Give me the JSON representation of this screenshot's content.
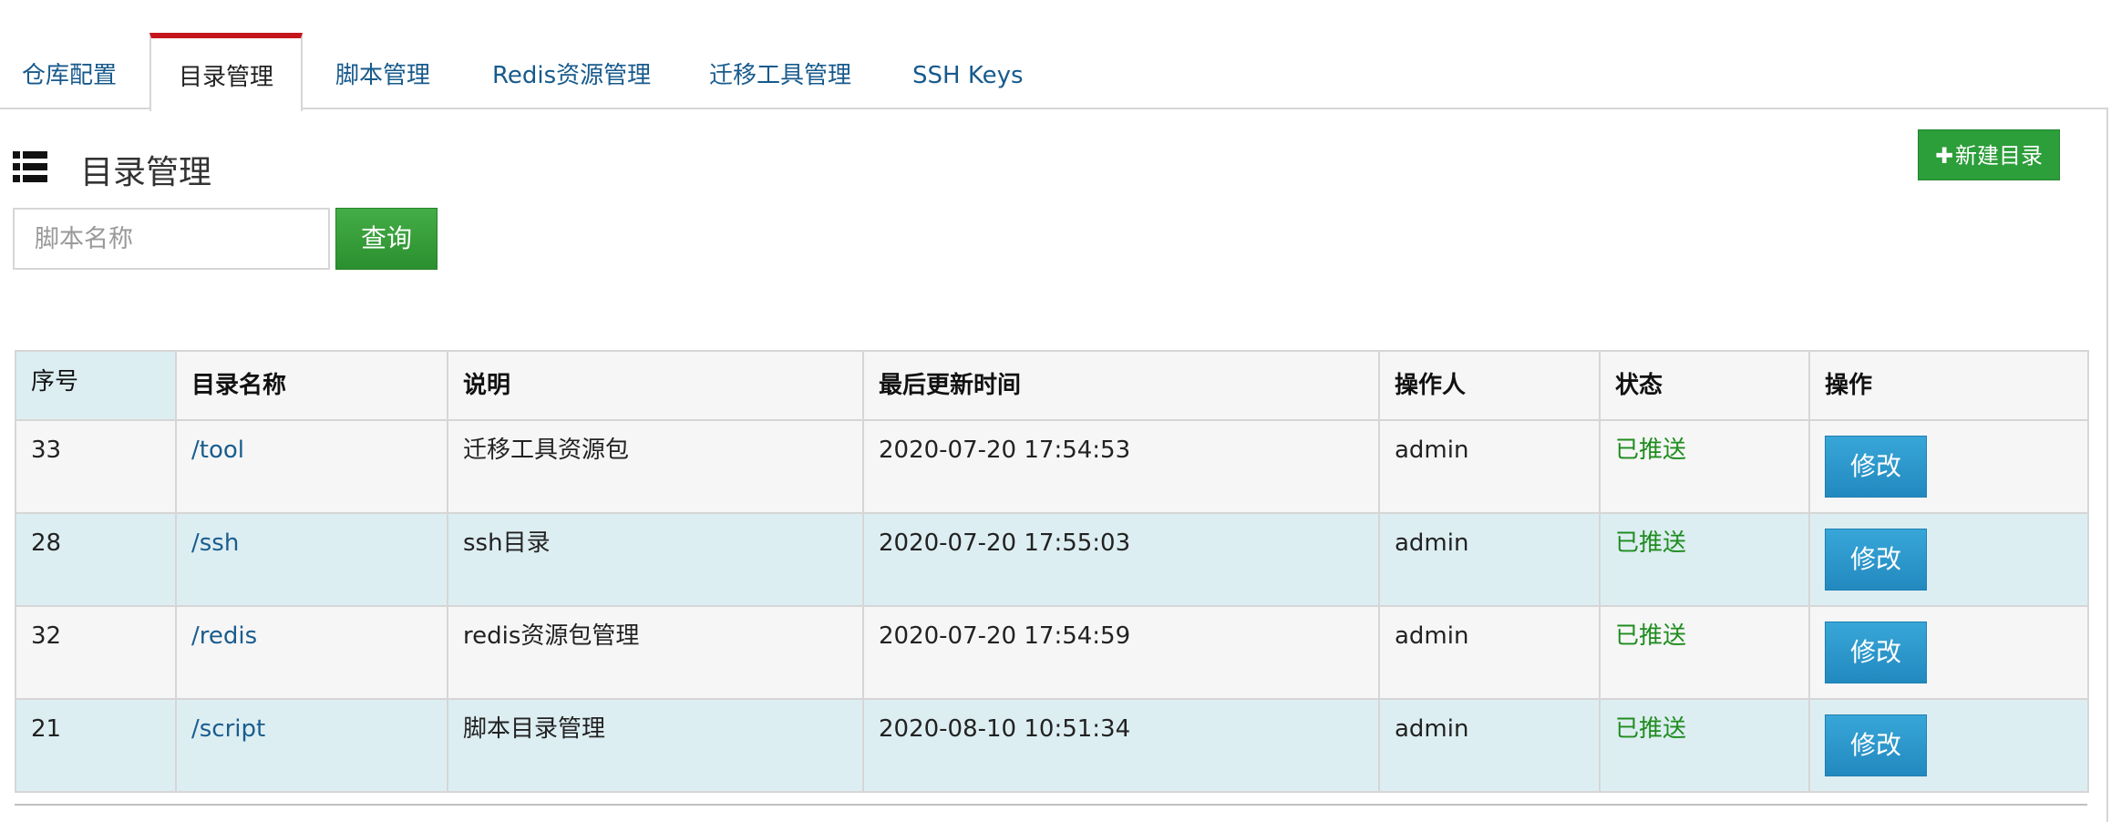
{
  "tabs": [
    {
      "label": "仓库配置"
    },
    {
      "label": "目录管理",
      "active": true
    },
    {
      "label": "脚本管理"
    },
    {
      "label": "Redis资源管理"
    },
    {
      "label": "迁移工具管理"
    },
    {
      "label": "SSH Keys"
    }
  ],
  "header": {
    "icon": "list-icon",
    "title": "目录管理",
    "new_button": {
      "icon": "plus-icon",
      "label": "新建目录"
    }
  },
  "search": {
    "placeholder": "脚本名称",
    "value": "",
    "button_label": "查询"
  },
  "table": {
    "columns": [
      "序号",
      "目录名称",
      "说明",
      "最后更新时间",
      "操作人",
      "状态",
      "操作"
    ],
    "rows": [
      {
        "id": "33",
        "name": "/tool",
        "desc": "迁移工具资源包",
        "updated": "2020-07-20 17:54:53",
        "operator": "admin",
        "status": "已推送",
        "action": "修改"
      },
      {
        "id": "28",
        "name": "/ssh",
        "desc": "ssh目录",
        "updated": "2020-07-20 17:55:03",
        "operator": "admin",
        "status": "已推送",
        "action": "修改"
      },
      {
        "id": "32",
        "name": "/redis",
        "desc": "redis资源包管理",
        "updated": "2020-07-20 17:54:59",
        "operator": "admin",
        "status": "已推送",
        "action": "修改"
      },
      {
        "id": "21",
        "name": "/script",
        "desc": "脚本目录管理",
        "updated": "2020-08-10 10:51:34",
        "operator": "admin",
        "status": "已推送",
        "action": "修改"
      }
    ]
  },
  "colors": {
    "active_tab_accent": "#c4161c",
    "link": "#175a8c",
    "success_button": "#2c9e3a",
    "status_ok": "#1f8c1f",
    "edit_button": "#2289bf",
    "row_alt": "#ddeef2"
  }
}
